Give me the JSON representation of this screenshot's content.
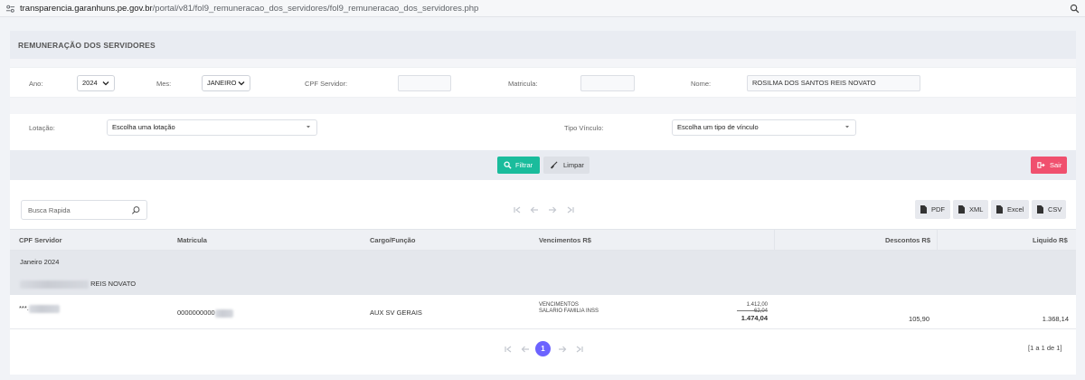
{
  "browser": {
    "host": "transparencia.garanhuns.pe.gov.br",
    "path": "/portal/v81/fol9_remuneracao_dos_servidores/fol9_remuneracao_dos_servidores.php"
  },
  "page": {
    "title": "REMUNERAÇÃO DOS SERVIDORES"
  },
  "filters": {
    "ano_label": "Ano:",
    "ano_value": "2024",
    "mes_label": "Mes:",
    "mes_value": "JANEIRO",
    "cpf_label": "CPF Servidor:",
    "cpf_value": "",
    "matricula_label": "Matricula:",
    "matricula_value": "",
    "nome_label": "Nome:",
    "nome_value": "ROSILMA DOS SANTOS REIS NOVATO",
    "lotacao_label": "Lotação:",
    "lotacao_value": "Escolha uma lotação",
    "vinculo_label": "Tipo Vínculo:",
    "vinculo_value": "Escolha um tipo de vínculo"
  },
  "actions": {
    "filtrar": "Filtrar",
    "limpar": "Limpar",
    "sair": "Sair"
  },
  "search": {
    "placeholder": "Busca Rapida"
  },
  "export": {
    "pdf": "PDF",
    "xml": "XML",
    "excel": "Excel",
    "csv": "CSV"
  },
  "table": {
    "headers": {
      "cpf": "CPF Servidor",
      "matricula": "Matricula",
      "cargo": "Cargo/Função",
      "vencimentos": "Vencimentos R$",
      "descontos": "Descontos R$",
      "liquido": "Liquido R$"
    },
    "group": {
      "period": "Janeiro  2024",
      "name_suffix": "REIS NOVATO"
    },
    "row": {
      "cpf_masked": "***.",
      "matricula_prefix": "0000000000",
      "cargo": "AUX SV GERAIS",
      "item1_label": "VENCIMENTOS",
      "item2_label": "SALARIO FAMILIA INSS",
      "item1_value": "1.412,00",
      "item2_value": "62,04",
      "vencimentos_total": "1.474,04",
      "descontos": "105,90",
      "liquido": "1.368,14"
    }
  },
  "pagination": {
    "current_page": "1",
    "info": "[1 a 1 de 1]"
  },
  "colors": {
    "accent_green": "#1abc9c",
    "danger": "#f0506e",
    "active_page": "#6c63ff"
  }
}
